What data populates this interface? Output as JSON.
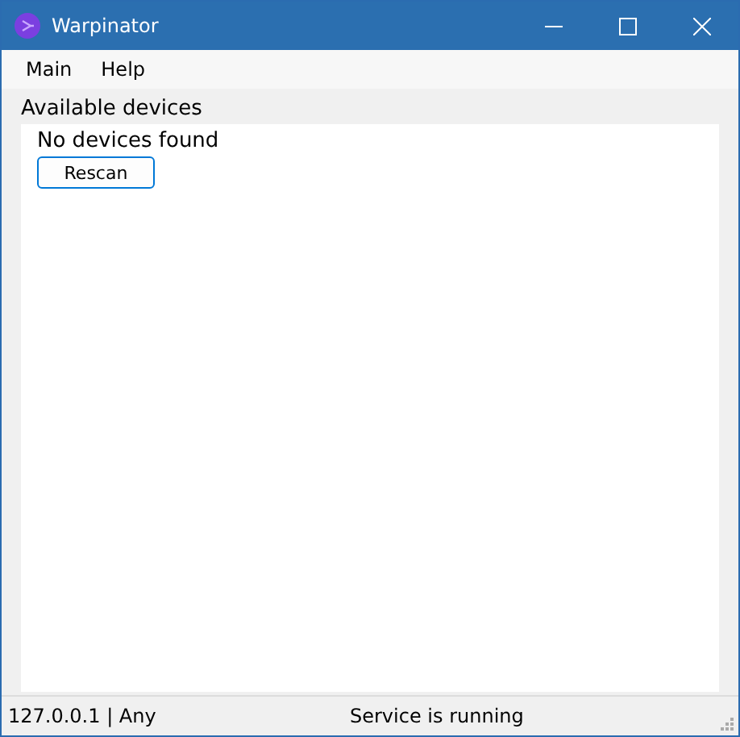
{
  "window": {
    "title": "Warpinator"
  },
  "menu": [
    "Main",
    "Help"
  ],
  "section": {
    "title": "Available devices",
    "message": "No devices found",
    "button": "Rescan"
  },
  "status_bar": {
    "address": "127.0.0.1 | Any",
    "status": "Service is running"
  }
}
